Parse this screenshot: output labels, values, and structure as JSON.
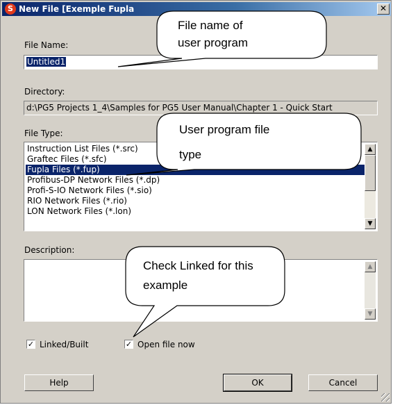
{
  "window": {
    "title": "New File [Exemple Fupla",
    "app_icon_glyph": "S",
    "close_glyph": "✕",
    "titlebar_colors": [
      "#0a246a",
      "#a6caf0"
    ]
  },
  "fields": {
    "file_name_label": "File Name:",
    "file_name_value": "Untitled1",
    "directory_label": "Directory:",
    "directory_value": "d:\\PG5 Projects 1_4\\Samples for PG5 User Manual\\Chapter 1 - Quick Start",
    "file_type_label": "File Type:",
    "description_label": "Description:",
    "description_value": ""
  },
  "file_types": [
    "Instruction List Files (*.src)",
    "Graftec Files (*.sfc)",
    "Fupla Files (*.fup)",
    "Profibus-DP Network Files (*.dp)",
    "Profi-S-IO Network Files (*.sio)",
    "RIO Network Files (*.rio)",
    "LON Network Files (*.lon)"
  ],
  "selected_file_type": "Fupla Files (*.fup)",
  "checkboxes": {
    "linked_built": {
      "label": "Linked/Built",
      "checked": true
    },
    "open_file_now": {
      "label": "Open file now",
      "checked": true
    },
    "check_glyph": "✓"
  },
  "buttons": {
    "help": "Help",
    "ok": "OK",
    "cancel": "Cancel"
  },
  "callouts": {
    "file_name": [
      "File name of",
      "user program"
    ],
    "file_type": [
      "User program file",
      "type"
    ],
    "linked": [
      "Check Linked for this",
      "example"
    ]
  },
  "scroll_glyphs": {
    "up": "▲",
    "down": "▼"
  }
}
